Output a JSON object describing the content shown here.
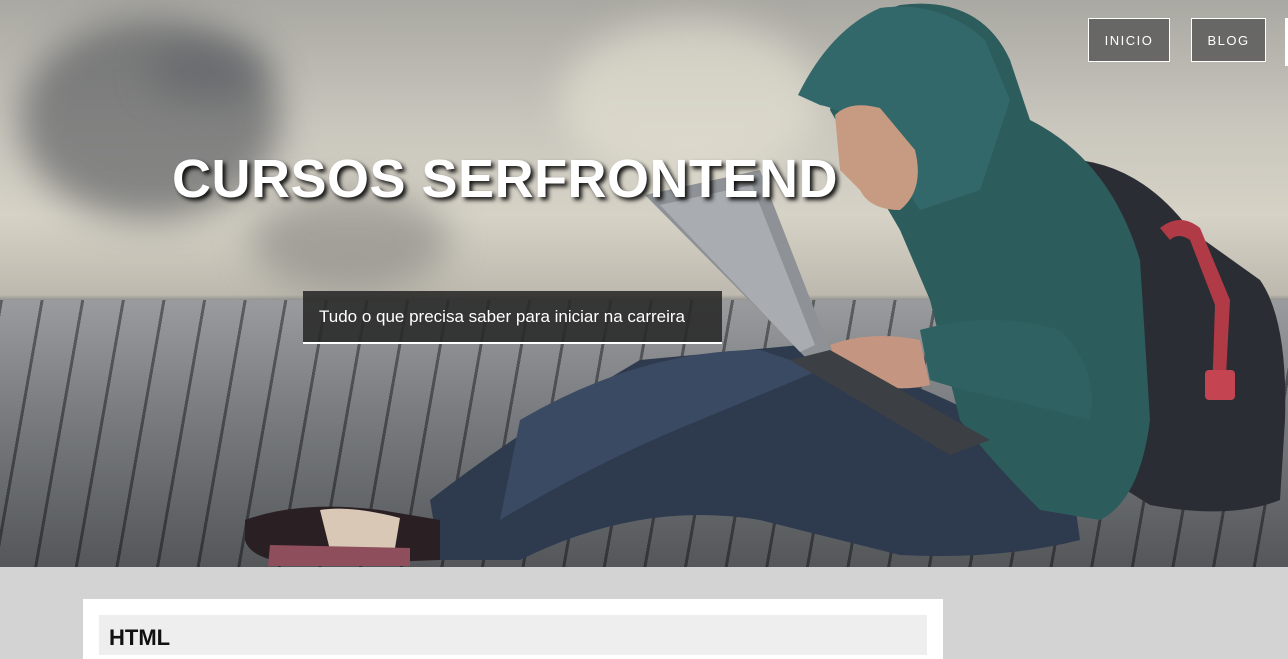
{
  "nav": {
    "items": [
      {
        "label": "INICIO"
      },
      {
        "label": "BLOG"
      }
    ]
  },
  "hero": {
    "title": "CURSOS SERFRONTEND",
    "subtitle": "Tudo o que precisa saber para iniciar na carreira"
  },
  "content": {
    "cards": [
      {
        "title": "HTML"
      }
    ]
  }
}
